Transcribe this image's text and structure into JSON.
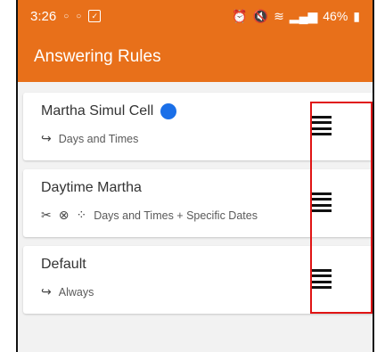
{
  "status_bar": {
    "time": "3:26",
    "left_icons": [
      "circle-notification-icon",
      "circle-notification-icon",
      "check-box-icon"
    ],
    "battery": "46%",
    "right_icons": [
      "alarm-icon",
      "mute-icon",
      "wifi-icon",
      "signal-icon",
      "battery-icon"
    ]
  },
  "app_bar": {
    "title": "Answering Rules"
  },
  "rules": [
    {
      "name": "Martha Simul Cell",
      "has_badge": true,
      "condition_icons": [
        "forward-icon"
      ],
      "condition": "Days and Times"
    },
    {
      "name": "Daytime Martha",
      "has_badge": false,
      "condition_icons": [
        "tools-icon",
        "cancel-icon",
        "dots-icon"
      ],
      "condition": "Days and Times + Specific Dates"
    },
    {
      "name": "Default",
      "has_badge": false,
      "condition_icons": [
        "forward-icon"
      ],
      "condition": "Always"
    }
  ],
  "colors": {
    "accent": "#e8701a",
    "badge": "#1a6fe8",
    "highlight": "#e01414"
  }
}
